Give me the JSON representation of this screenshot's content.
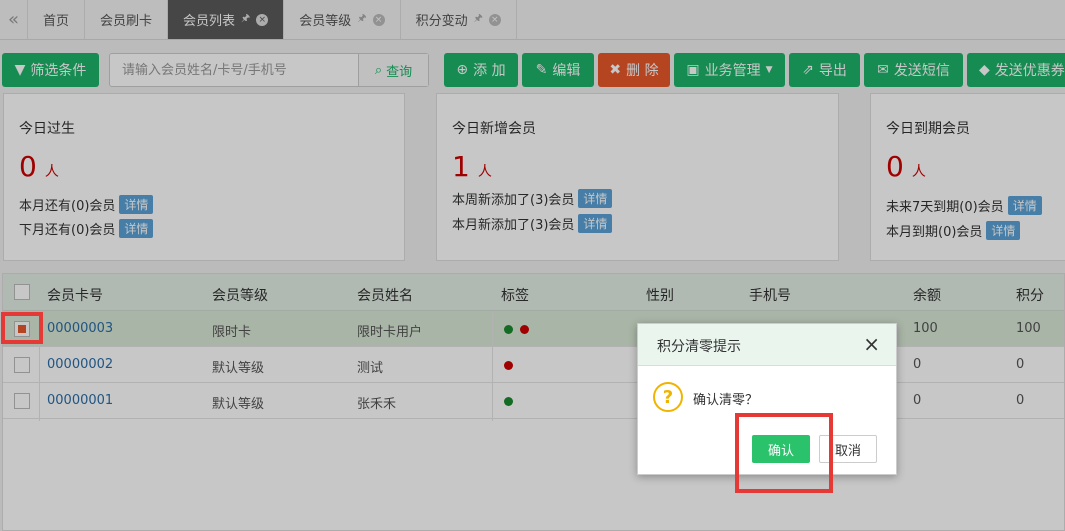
{
  "tabs": {
    "collapse_icon": "«",
    "items": [
      {
        "label": "首页"
      },
      {
        "label": "会员刷卡"
      },
      {
        "label": "会员列表",
        "active": true
      },
      {
        "label": "会员等级"
      },
      {
        "label": "积分变动"
      }
    ]
  },
  "toolbar": {
    "filter_label": "筛选条件",
    "search_placeholder": "请输入会员姓名/卡号/手机号",
    "search_label": "查询",
    "add_label": "添 加",
    "edit_label": "编辑",
    "delete_label": "删 除",
    "business_label": "业务管理",
    "export_label": "导出",
    "sms_label": "发送短信",
    "coupon_label": "发送优惠券"
  },
  "cards": {
    "birthday": {
      "title": "今日过生",
      "count": "0",
      "unit": "人",
      "line1": "本月还有(0)会员",
      "line2": "下月还有(0)会员",
      "detail": "详情"
    },
    "new_members": {
      "title": "今日新增会员",
      "count": "1",
      "unit": "人",
      "line1": "本周新添加了(3)会员",
      "line2": "本月新添加了(3)会员",
      "detail": "详情"
    },
    "expiring": {
      "title": "今日到期会员",
      "count": "0",
      "unit": "人",
      "line1": "未来7天到期(0)会员",
      "line2": "本月到期(0)会员",
      "detail": "详情"
    }
  },
  "table": {
    "headers": [
      "会员卡号",
      "会员等级",
      "会员姓名",
      "标签",
      "性别",
      "手机号",
      "余额",
      "积分"
    ],
    "rows": [
      {
        "card": "00000003",
        "level": "限时卡",
        "name": "限时卡用户",
        "tags": [
          "green",
          "red"
        ],
        "balance": "100",
        "points": "100",
        "selected": true
      },
      {
        "card": "00000002",
        "level": "默认等级",
        "name": "测试",
        "tags": [
          "red"
        ],
        "balance": "0",
        "points": "0",
        "selected": false
      },
      {
        "card": "00000001",
        "level": "默认等级",
        "name": "张禾禾",
        "tags": [
          "green"
        ],
        "balance": "0",
        "points": "0",
        "selected": false
      }
    ]
  },
  "dialog": {
    "title": "积分清零提示",
    "close_icon": "×",
    "icon": "?",
    "message": "确认清零？",
    "ok_label": "确认",
    "cancel_label": "取消"
  },
  "colors": {
    "primary": "#1db46a",
    "danger": "#e8582a",
    "highlight": "#e53935"
  }
}
